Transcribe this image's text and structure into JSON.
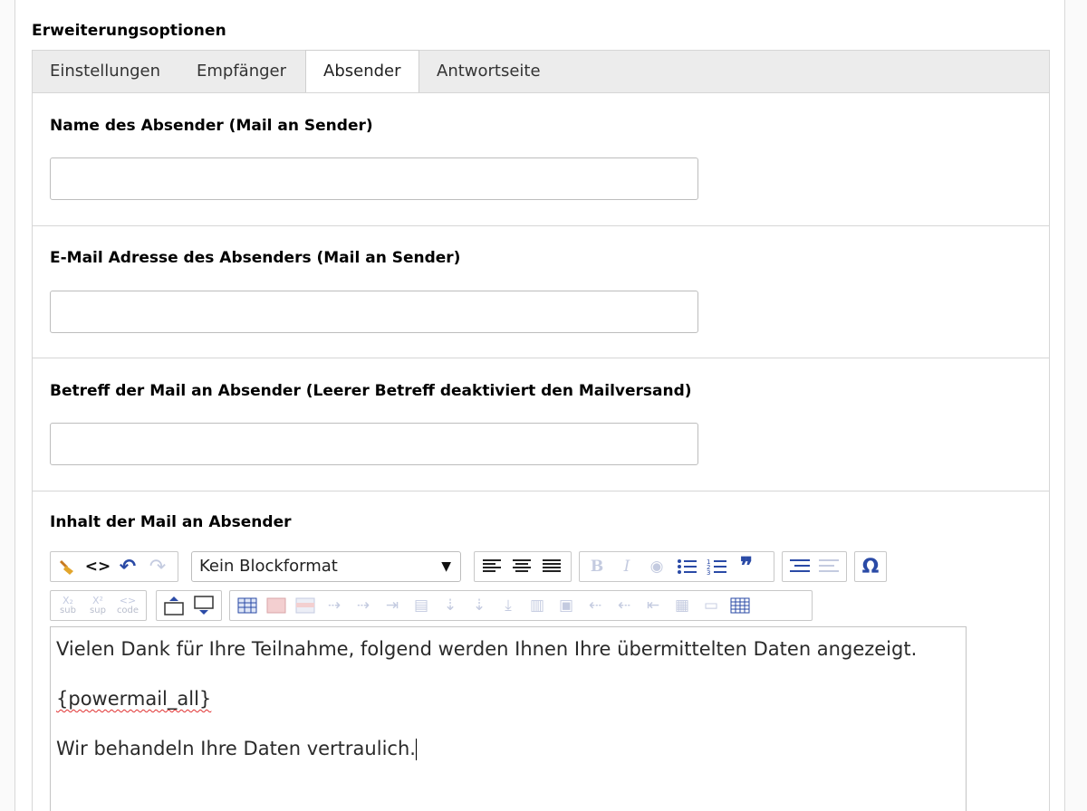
{
  "section": {
    "title": "Erweiterungsoptionen"
  },
  "tabs": [
    {
      "label": "Einstellungen",
      "active": false
    },
    {
      "label": "Empfänger",
      "active": false
    },
    {
      "label": "Absender",
      "active": true
    },
    {
      "label": "Antwortseite",
      "active": false
    }
  ],
  "fields": {
    "sender_name": {
      "label": "Name des Absender (Mail an Sender)",
      "value": ""
    },
    "sender_email": {
      "label": "E-Mail Adresse des Absenders (Mail an Sender)",
      "value": ""
    },
    "subject": {
      "label": "Betreff der Mail an Absender (Leerer Betreff deaktiviert den Mailversand)",
      "value": ""
    },
    "content": {
      "label": "Inhalt der Mail an Absender"
    }
  },
  "toolbar": {
    "blockformat": "Kein Blockformat",
    "sub": "sub",
    "sup": "sup",
    "code": "code",
    "omega": "Ω",
    "bold": "B",
    "italic": "I"
  },
  "editor": {
    "lines": [
      "Vielen Dank für Ihre Teilnahme, folgend werden Ihnen Ihre übermittelten Daten angezeigt.",
      "{powermail_all}",
      "Wir behandeln Ihre Daten vertraulich."
    ]
  },
  "colors": {
    "accent": "#2a4aa6",
    "border": "#d6d6d6",
    "tabbar": "#ececec"
  }
}
